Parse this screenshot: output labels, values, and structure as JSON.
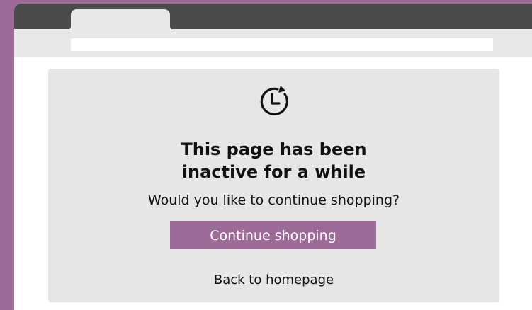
{
  "window": {
    "frame_color": "#9e6a98",
    "titlebar_color": "#4a4a4a",
    "toolbar_color": "#e8e8e8"
  },
  "dialog": {
    "icon": "clock-refresh-icon",
    "title_line1": "This page has been",
    "title_line2": "inactive for a while",
    "question": "Would you like to continue shopping?",
    "primary_button": "Continue shopping",
    "secondary_link": "Back to homepage",
    "accent_color": "#9e6a98",
    "card_color": "#e6e6e6"
  }
}
